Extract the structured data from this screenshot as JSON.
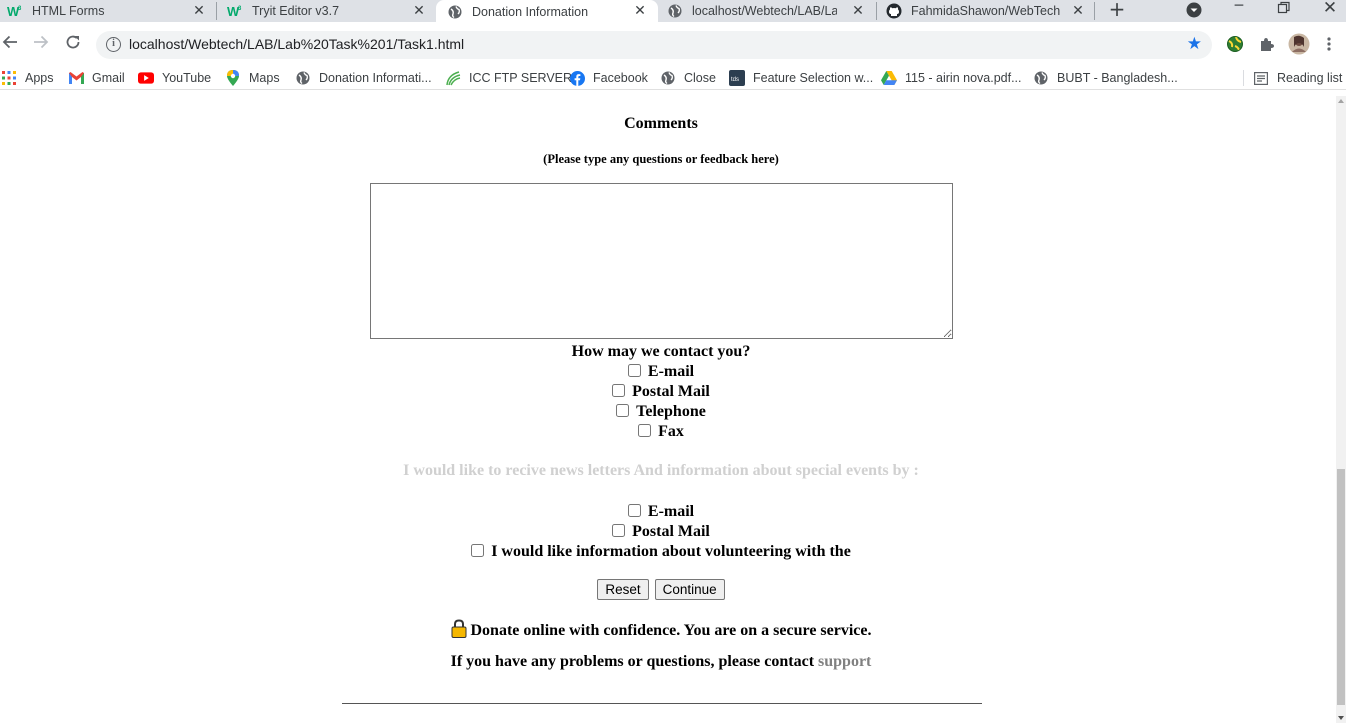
{
  "browser": {
    "tabs": [
      {
        "title": "HTML Forms",
        "icon": "w3schools-icon",
        "active": false
      },
      {
        "title": "Tryit Editor v3.7",
        "icon": "w3schools-icon",
        "active": false
      },
      {
        "title": "Donation Information",
        "icon": "globe-icon",
        "active": true
      },
      {
        "title": "localhost/Webtech/LAB/Lab T",
        "icon": "globe-icon",
        "active": false
      },
      {
        "title": "FahmidaShawon/WebTech",
        "icon": "github-icon",
        "active": false
      }
    ],
    "new_tab_label": "+",
    "url": "localhost/Webtech/LAB/Lab%20Task%201/Task1.html",
    "bookmarks": [
      {
        "label": "Apps",
        "icon": "apps-grid-icon"
      },
      {
        "label": "Gmail",
        "icon": "gmail-icon"
      },
      {
        "label": "YouTube",
        "icon": "youtube-icon"
      },
      {
        "label": "Maps",
        "icon": "maps-icon"
      },
      {
        "label": "Donation Informati...",
        "icon": "globe-icon"
      },
      {
        "label": "ICC FTP SERVER",
        "icon": "icc-icon"
      },
      {
        "label": "Facebook",
        "icon": "facebook-icon"
      },
      {
        "label": "Close",
        "icon": "globe-icon"
      },
      {
        "label": "Feature Selection w...",
        "icon": "tds-icon"
      },
      {
        "label": "115 - airin nova.pdf...",
        "icon": "google-drive-icon"
      },
      {
        "label": "BUBT - Bangladesh...",
        "icon": "globe-icon"
      }
    ],
    "reading_list_label": "Reading list",
    "colors": {
      "tabstrip": "#dee1e6",
      "star": "#1a73e8"
    }
  },
  "form": {
    "comments_heading": "Comments",
    "comments_subheading": "(Please type any questions or feedback here)",
    "comments_value": "",
    "contact_question": "How may we contact you?",
    "contact_options": [
      "E-mail",
      "Postal Mail",
      "Telephone",
      "Fax"
    ],
    "newsletter_text": "I would like to recive news letters And information about special events by :",
    "newsletter_options": [
      "E-mail",
      "Postal Mail"
    ],
    "volunteer_text": "I would like information about volunteering with the",
    "reset_label": "Reset",
    "continue_label": "Continue",
    "secure_text": "Donate online with confidence. You are on a secure service.",
    "problems_text": "If you have any problems or questions, please contact",
    "support_link": "support"
  }
}
